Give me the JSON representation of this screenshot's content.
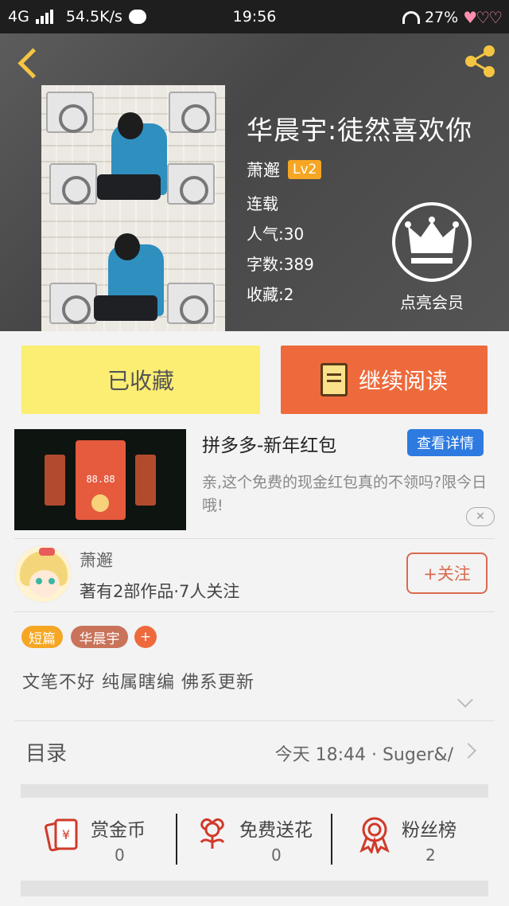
{
  "status_bar": {
    "network": "4G",
    "speed": "54.5K/s",
    "time": "19:56",
    "battery": "27%"
  },
  "book": {
    "title": "华晨宇:徒然喜欢你",
    "author": "萧邂",
    "level": "Lv2",
    "status": "连载",
    "popularity_label": "人气:30",
    "words_label": "字数:389",
    "favorites_label": "收藏:2",
    "vip_label": "点亮会员"
  },
  "actions": {
    "favorite_label": "已收藏",
    "read_label": "继续阅读"
  },
  "ad": {
    "title": "拼多多-新年红包",
    "detail_label": "查看详情",
    "description": "亲,这个免费的现金红包真的不领吗?限今日哦!",
    "amount": "88.88",
    "close_symbol": "✕"
  },
  "author_card": {
    "name": "萧邂",
    "info": "著有2部作品·7人关注",
    "follow_label": "+关注"
  },
  "tags": [
    "短篇",
    "华晨宇",
    "+"
  ],
  "tag_colors": [
    "#f5a623",
    "#c8735a",
    "#ee6a3c"
  ],
  "summary": "文笔不好  纯属瞎编  佛系更新",
  "toc": {
    "label": "目录",
    "latest": "今天 18:44 · Suger&/"
  },
  "stats": [
    {
      "label": "赏金币",
      "value": "0",
      "icon": "coin-icon"
    },
    {
      "label": "免费送花",
      "value": "0",
      "icon": "flower-icon"
    },
    {
      "label": "粉丝榜",
      "value": "2",
      "icon": "ribbon-icon"
    }
  ],
  "colors": {
    "accent_yellow": "#fbee72",
    "accent_orange": "#ee6a3c",
    "ad_blue": "#2d7ae0",
    "icon_red": "#d03a2a"
  }
}
